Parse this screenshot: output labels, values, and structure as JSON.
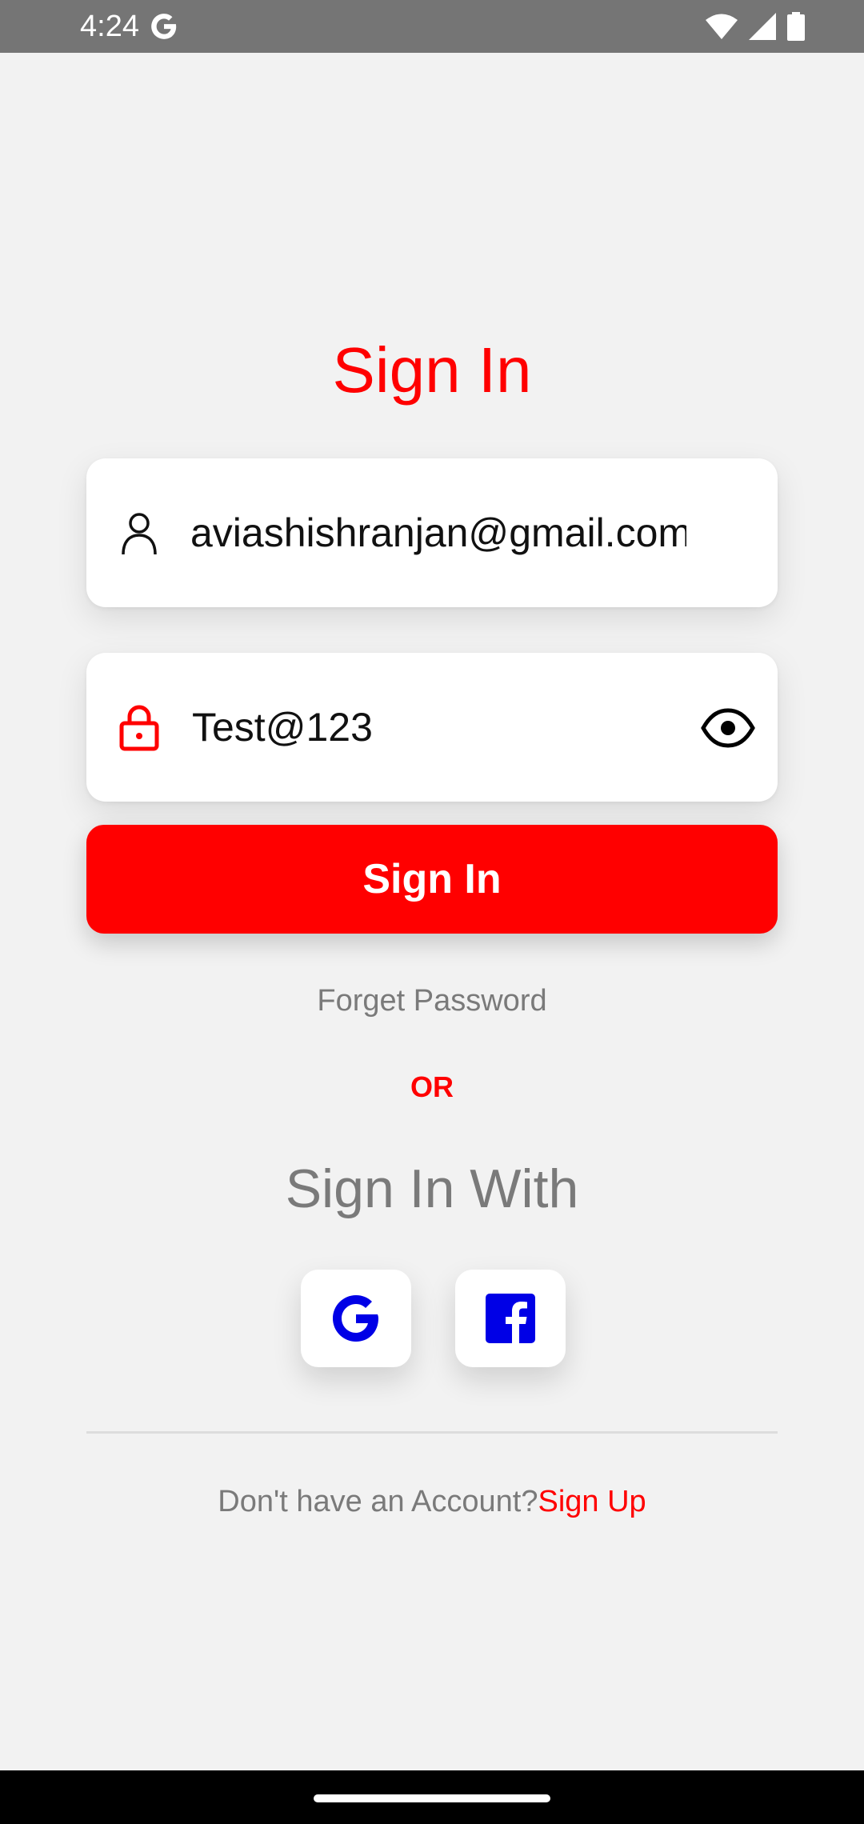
{
  "status_bar": {
    "time": "4:24",
    "icons": [
      "google-g-icon",
      "wifi-icon",
      "signal-icon",
      "battery-icon"
    ]
  },
  "screen": {
    "title": "Sign In"
  },
  "email_field": {
    "icon": "user-icon",
    "value": "aviashishranjan@gmail.com"
  },
  "password_field": {
    "icon": "lock-icon",
    "value": "Test@123",
    "toggle_icon": "eye-icon"
  },
  "signin_button": {
    "label": "Sign In"
  },
  "forget_password": {
    "label": "Forget Password"
  },
  "separator": {
    "label": "OR"
  },
  "social": {
    "heading": "Sign In With",
    "buttons": [
      {
        "name": "google",
        "icon": "google-icon"
      },
      {
        "name": "facebook",
        "icon": "facebook-icon"
      }
    ]
  },
  "footer": {
    "prompt": "Don't have an Account?",
    "link": "Sign Up"
  },
  "colors": {
    "accent": "#ff0000",
    "background": "#f2f2f2",
    "muted_text": "#7a7a7a",
    "social_icon_blue": "#0000e6"
  }
}
